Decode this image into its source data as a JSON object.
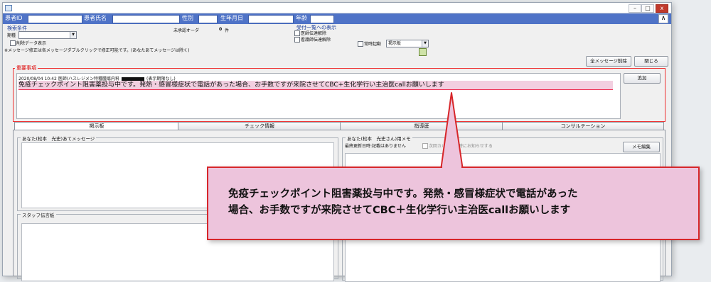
{
  "patient_bar": {
    "patient_id_label": "患者ID",
    "patient_name_label": "患者氏名",
    "sex_label": "性別",
    "birthdate_label": "生年月日",
    "age_label": "年齢",
    "scroll_up": "∧"
  },
  "window_controls": {
    "minimize": "–",
    "maximize": "□",
    "close": "x"
  },
  "search": {
    "title": "検索条件",
    "period_label": "期種",
    "period_value": "",
    "include_deleted_label": "削除データ表示",
    "note": "※メッセージ修正は各メッセージダブルクリックで修正可能です。(あなたあてメッセージは除く)"
  },
  "unapproved": {
    "label": "未承認オーダ",
    "count": "0",
    "unit": "件"
  },
  "reception_list": {
    "title": "受付一覧への表示",
    "doctor_notice_label": "医師伝達解除",
    "nurse_notice_label": "看護師伝達解除"
  },
  "auto_start": {
    "label": "常時起動",
    "value": "掲示板"
  },
  "buttons": {
    "delete_all": "全メッセージ削除",
    "close": "閉じる",
    "add": "追加",
    "memo_edit": "メモ編集"
  },
  "important": {
    "title": "重要事項",
    "header": "2020/08/04 10:42 医師(ハスレジメン特種腫瘍内科",
    "header_suffix": "(表示期限なし)",
    "message": "免疫チェックポイント阻害薬投与中です。発熱・感冒様症状で電話があった場合、お手数ですが来院させてCBC+生化学行い主治医callお願いします"
  },
  "tabs": [
    "掲示板",
    "チェック情報",
    "指導歴",
    "コンサルテーション"
  ],
  "panels": {
    "to_you_title": "あなた(松本　光史)あてメッセージ",
    "memo_title": "あなた(松本　光史さん)用メモ",
    "memo_updated": "最終更新日時:記載はありません",
    "memo_notify": "次回カルテ起動時にお知らせする",
    "staff_title": "スタッフ伝言板"
  },
  "callout": {
    "line1": "免疫チェックポイント阻害薬投与中です。発熱・感冒様症状で電話があった",
    "line2": "場合、お手数ですが来院させてCBC＋生化学行い主治医callお願いします"
  },
  "colors": {
    "patient_bar": "#4f73c7",
    "callout_fill": "#edc4dc",
    "callout_border": "#d7262a",
    "important_border": "#ee3333"
  }
}
